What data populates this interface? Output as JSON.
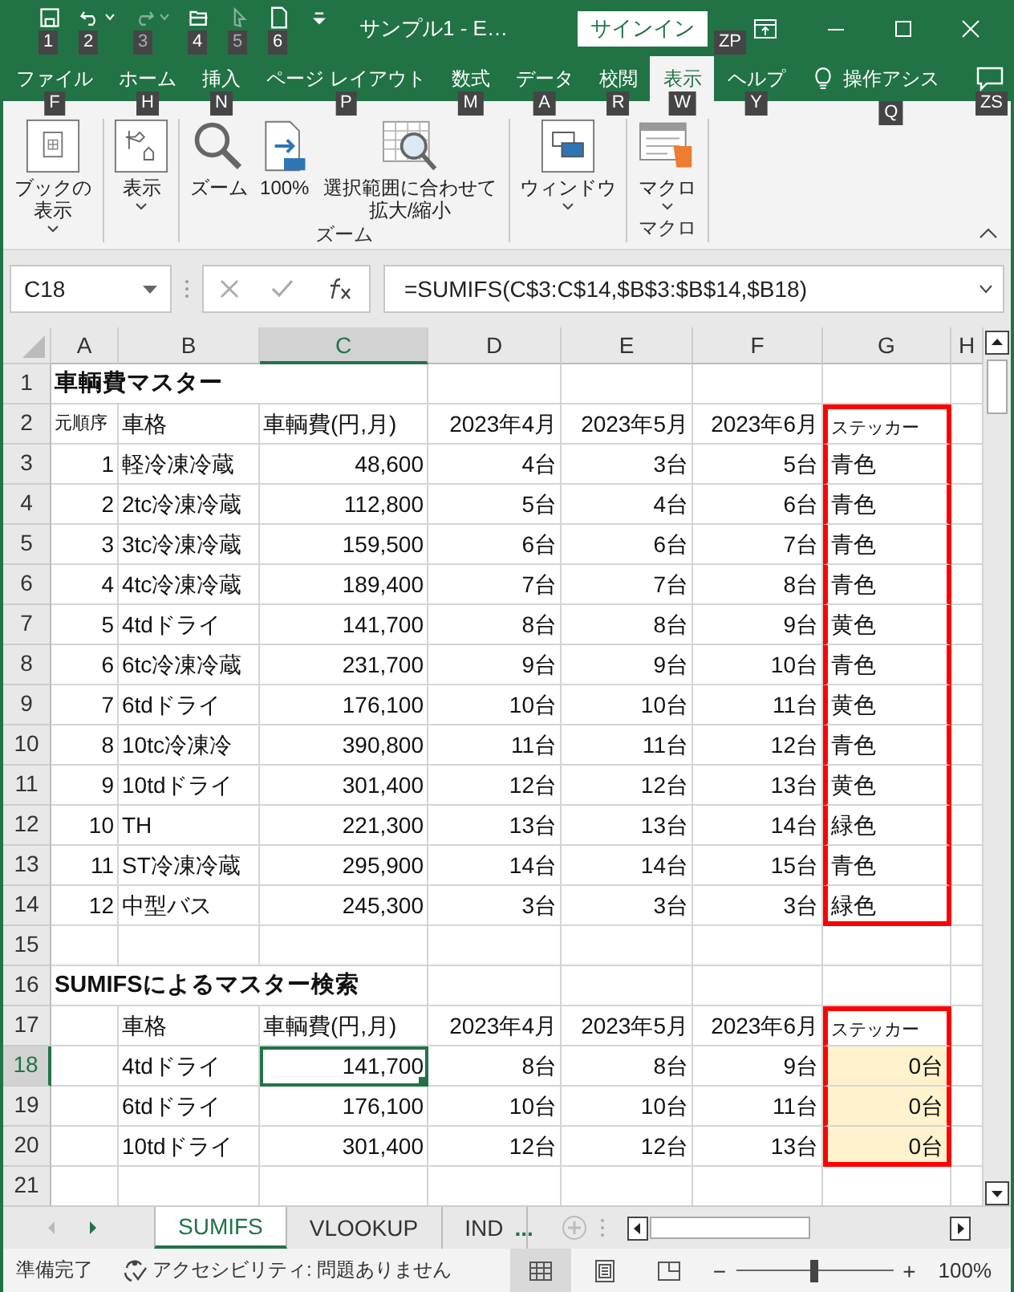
{
  "title_bar": {
    "quick_access": [
      {
        "kind": "save",
        "keytip": "1",
        "disabled": false,
        "dropdown": false
      },
      {
        "kind": "undo",
        "keytip": "2",
        "disabled": false,
        "dropdown": true
      },
      {
        "kind": "redo",
        "keytip": "3",
        "disabled": true,
        "dropdown": true
      },
      {
        "kind": "open",
        "keytip": "4",
        "disabled": false,
        "dropdown": false
      },
      {
        "kind": "touch",
        "keytip": "5",
        "disabled": true,
        "dropdown": false
      },
      {
        "kind": "new",
        "keytip": "6",
        "disabled": false,
        "dropdown": false
      },
      {
        "kind": "customize",
        "disabled": false,
        "dropdown": false
      }
    ],
    "title": "サンプル1 - E…",
    "sign_in": {
      "label": "サインイン",
      "keytip": "ZP"
    }
  },
  "ribbon_tabs": [
    {
      "label": "ファイル",
      "keytip": "F",
      "selected": false
    },
    {
      "label": "ホーム",
      "keytip": "H",
      "selected": false
    },
    {
      "label": "挿入",
      "keytip": "N",
      "selected": false
    },
    {
      "label": "ページ レイアウト",
      "keytip": "P",
      "selected": false
    },
    {
      "label": "数式",
      "keytip": "M",
      "selected": false
    },
    {
      "label": "データ",
      "keytip": "A",
      "selected": false
    },
    {
      "label": "校閲",
      "keytip": "R",
      "selected": false
    },
    {
      "label": "表示",
      "keytip": "W",
      "selected": true
    },
    {
      "label": "ヘルプ",
      "keytip": "Y",
      "selected": false
    }
  ],
  "tell_me": {
    "label": "操作アシス",
    "keytip": "Q"
  },
  "comments": {
    "keytip": "ZS"
  },
  "ribbon_groups": [
    {
      "buttons": [
        {
          "kind": "workbook-views",
          "label": "ブックの表示",
          "dropdown": true
        }
      ]
    },
    {
      "buttons": [
        {
          "kind": "show",
          "label": "表示",
          "dropdown": true
        }
      ]
    },
    {
      "label": "ズーム",
      "buttons": [
        {
          "kind": "zoom",
          "label": "ズーム",
          "dropdown": false
        },
        {
          "kind": "zoom-100",
          "label": "100%",
          "dropdown": false
        },
        {
          "kind": "zoom-selection",
          "label": "選択範囲に合わせて拡大/縮小",
          "dropdown": false
        }
      ]
    },
    {
      "buttons": [
        {
          "kind": "window",
          "label": "ウィンドウ",
          "dropdown": true
        }
      ]
    },
    {
      "label": "マクロ",
      "buttons": [
        {
          "kind": "macro",
          "label": "マクロ",
          "dropdown": true
        }
      ]
    }
  ],
  "formula_bar": {
    "name_box": "C18",
    "formula": "=SUMIFS(C$3:C$14,$B$3:$B$14,$B18)"
  },
  "columns": [
    {
      "label": "A",
      "selected": false
    },
    {
      "label": "B",
      "selected": false
    },
    {
      "label": "C",
      "selected": true
    },
    {
      "label": "D",
      "selected": false
    },
    {
      "label": "E",
      "selected": false
    },
    {
      "label": "F",
      "selected": false
    },
    {
      "label": "G",
      "selected": false
    },
    {
      "label": "H",
      "selected": false
    }
  ],
  "rows": [
    {
      "number": "1",
      "kind": "title",
      "selected": false,
      "framed": false,
      "cells": [
        "車輌費マスター"
      ]
    },
    {
      "number": "2",
      "kind": "header",
      "selected": false,
      "framed": true,
      "cells": [
        "元順序",
        "車格",
        "車輌費(円,月)",
        "2023年4月",
        "2023年5月",
        "2023年6月",
        "ステッカー"
      ]
    },
    {
      "number": "3",
      "kind": "data",
      "selected": false,
      "framed": true,
      "cells": [
        "1",
        "軽冷凍冷蔵",
        "48,600",
        "4台",
        "3台",
        "5台",
        "青色"
      ]
    },
    {
      "number": "4",
      "kind": "data",
      "selected": false,
      "framed": true,
      "cells": [
        "2",
        "2tc冷凍冷蔵",
        "112,800",
        "5台",
        "4台",
        "6台",
        "青色"
      ]
    },
    {
      "number": "5",
      "kind": "data",
      "selected": false,
      "framed": true,
      "cells": [
        "3",
        "3tc冷凍冷蔵",
        "159,500",
        "6台",
        "6台",
        "7台",
        "青色"
      ]
    },
    {
      "number": "6",
      "kind": "data",
      "selected": false,
      "framed": true,
      "cells": [
        "4",
        "4tc冷凍冷蔵",
        "189,400",
        "7台",
        "7台",
        "8台",
        "青色"
      ]
    },
    {
      "number": "7",
      "kind": "data",
      "selected": false,
      "framed": true,
      "cells": [
        "5",
        "4tdドライ",
        "141,700",
        "8台",
        "8台",
        "9台",
        "黄色"
      ]
    },
    {
      "number": "8",
      "kind": "data",
      "selected": false,
      "framed": true,
      "cells": [
        "6",
        "6tc冷凍冷蔵",
        "231,700",
        "9台",
        "9台",
        "10台",
        "青色"
      ]
    },
    {
      "number": "9",
      "kind": "data",
      "selected": false,
      "framed": true,
      "cells": [
        "7",
        "6tdドライ",
        "176,100",
        "10台",
        "10台",
        "11台",
        "黄色"
      ]
    },
    {
      "number": "10",
      "kind": "data",
      "selected": false,
      "framed": true,
      "cells": [
        "8",
        "10tc冷凍冷",
        "390,800",
        "11台",
        "11台",
        "12台",
        "青色"
      ]
    },
    {
      "number": "11",
      "kind": "data",
      "selected": false,
      "framed": true,
      "cells": [
        "9",
        "10tdドライ",
        "301,400",
        "12台",
        "12台",
        "13台",
        "黄色"
      ]
    },
    {
      "number": "12",
      "kind": "data",
      "selected": false,
      "framed": true,
      "cells": [
        "10",
        "TH",
        "221,300",
        "13台",
        "13台",
        "14台",
        "緑色"
      ]
    },
    {
      "number": "13",
      "kind": "data",
      "selected": false,
      "framed": true,
      "cells": [
        "11",
        "ST冷凍冷蔵",
        "295,900",
        "14台",
        "14台",
        "15台",
        "青色"
      ]
    },
    {
      "number": "14",
      "kind": "data",
      "selected": false,
      "framed": true,
      "cells": [
        "12",
        "中型バス",
        "245,300",
        "3台",
        "3台",
        "3台",
        "緑色"
      ]
    },
    {
      "number": "15",
      "kind": "data",
      "selected": false,
      "framed": false,
      "cells": []
    },
    {
      "number": "16",
      "kind": "title",
      "selected": false,
      "framed": false,
      "cells": [
        "SUMIFSによるマスター検索"
      ]
    },
    {
      "number": "17",
      "kind": "header",
      "selected": false,
      "framed": true,
      "cells": [
        null,
        "車格",
        "車輌費(円,月)",
        "2023年4月",
        "2023年5月",
        "2023年6月",
        "ステッカー"
      ]
    },
    {
      "number": "18",
      "kind": "lookup",
      "selected": true,
      "framed": true,
      "cells": [
        null,
        "4tdドライ",
        "141,700",
        "8台",
        "8台",
        "9台",
        "0台"
      ]
    },
    {
      "number": "19",
      "kind": "lookup",
      "selected": false,
      "framed": true,
      "cells": [
        null,
        "6tdドライ",
        "176,100",
        "10台",
        "10台",
        "11台",
        "0台"
      ]
    },
    {
      "number": "20",
      "kind": "lookup",
      "selected": false,
      "framed": true,
      "cells": [
        null,
        "10tdドライ",
        "301,400",
        "12台",
        "12台",
        "13台",
        "0台"
      ]
    },
    {
      "number": "21",
      "kind": "data",
      "selected": false,
      "framed": false,
      "cells": []
    }
  ],
  "sheet_tabs": [
    {
      "label": "SUMIFS",
      "selected": true
    },
    {
      "label": "VLOOKUP",
      "selected": false
    },
    {
      "label": "IND",
      "selected": false
    }
  ],
  "more_sheets": "...",
  "status_bar": {
    "status": "準備完了",
    "accessibility": "アクセシビリティ: 問題ありません",
    "views": [
      {
        "kind": "normal",
        "selected": true
      },
      {
        "kind": "page-layout",
        "selected": false
      },
      {
        "kind": "page-break",
        "selected": false
      }
    ],
    "zoom": {
      "minus": "−",
      "plus": "+",
      "level": 0.5,
      "label": "100%"
    }
  }
}
